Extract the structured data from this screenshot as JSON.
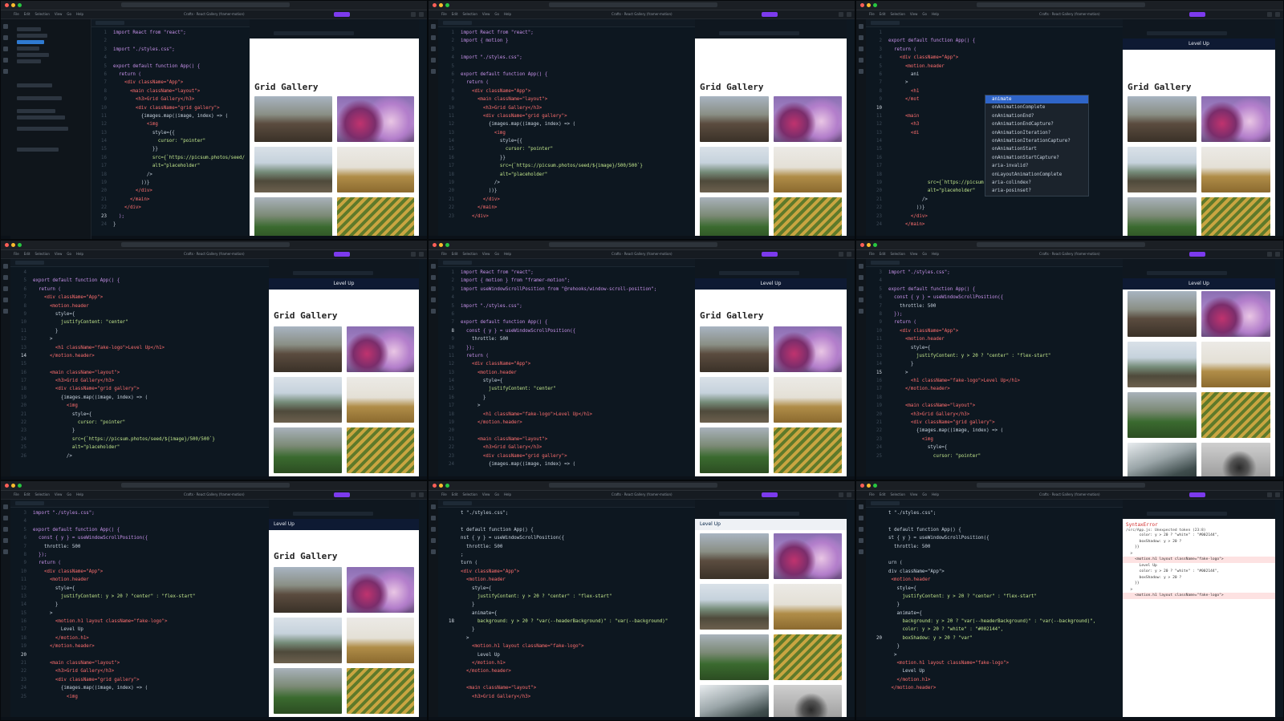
{
  "menu": [
    "File",
    "Edit",
    "Selection",
    "View",
    "Go",
    "Help"
  ],
  "project_title": "Crafts · React Gallery (framer-motion)",
  "code_tab": "App.jsx",
  "preview": {
    "gallery_title": "Grid Gallery",
    "header_logo": "Level Up"
  },
  "autocomplete": [
    "animate",
    "onAnimationComplete",
    "onAnimationEnd?",
    "onAnimationEndCapture?",
    "onAnimationIteration?",
    "onAnimationIterationCapture?",
    "onAnimationStart",
    "onAnimationStartCapture?",
    "aria-invalid?",
    "onLayoutAnimationComplete",
    "aria-colindex?",
    "aria-posinset?"
  ],
  "error": {
    "title": "SyntaxError",
    "message": "/src/App.js: Unexpected token (23:8)",
    "lines": [
      "      color: y > 20 ? \"white\" : \"#002144\",",
      "      boxShadow: y > 20 ?",
      "    }}",
      "  >",
      "    <motion.h1 layout className=\"fake-logo\">",
      "      Level Up",
      "      color: y > 20 ? \"white\" : \"#002144\",",
      "      boxShadow: y > 20 ?",
      "    }}",
      "  >",
      "    <motion.h1 layout className=\"fake-logo\">"
    ]
  },
  "panels": [
    {
      "id": "p1",
      "lines": [
        {
          "n": "1",
          "t": "import React from \"react\";"
        },
        {
          "n": "2",
          "t": ""
        },
        {
          "n": "3",
          "t": "import \"./styles.css\";"
        },
        {
          "n": "4",
          "t": ""
        },
        {
          "n": "5",
          "t": "export default function App() {"
        },
        {
          "n": "6",
          "t": "  return ("
        },
        {
          "n": "7",
          "t": "    <div className=\"App\">"
        },
        {
          "n": "8",
          "t": "      <main className=\"layout\">"
        },
        {
          "n": "9",
          "t": "        <h3>Grid Gallery</h3>"
        },
        {
          "n": "10",
          "t": "        <div className=\"grid gallery\">"
        },
        {
          "n": "11",
          "t": "          {images.map((image, index) => ("
        },
        {
          "n": "12",
          "t": "            <img"
        },
        {
          "n": "13",
          "t": "              style={{"
        },
        {
          "n": "14",
          "t": "                cursor: \"pointer\""
        },
        {
          "n": "15",
          "t": "              }}"
        },
        {
          "n": "16",
          "t": "              src={`https://picsum.photos/seed/"
        },
        {
          "n": "17",
          "t": "              alt=\"placeholder\""
        },
        {
          "n": "18",
          "t": "            />"
        },
        {
          "n": "19",
          "t": "          ))}"
        },
        {
          "n": "20",
          "t": "        </div>"
        },
        {
          "n": "21",
          "t": "      </main>"
        },
        {
          "n": "22",
          "t": "    </div>"
        },
        {
          "n": "23",
          "t": "  );"
        },
        {
          "n": "24",
          "t": "}"
        }
      ]
    },
    {
      "id": "p2",
      "lines": [
        {
          "n": "1",
          "t": "import React from \"react\";"
        },
        {
          "n": "2",
          "t": "import { motion }"
        },
        {
          "n": "3",
          "t": ""
        },
        {
          "n": "4",
          "t": "import \"./styles.css\";"
        },
        {
          "n": "5",
          "t": ""
        },
        {
          "n": "6",
          "t": "export default function App() {"
        },
        {
          "n": "7",
          "t": "  return ("
        },
        {
          "n": "8",
          "t": "    <div className=\"App\">"
        },
        {
          "n": "9",
          "t": "      <main className=\"layout\">"
        },
        {
          "n": "10",
          "t": "        <h3>Grid Gallery</h3>"
        },
        {
          "n": "11",
          "t": "        <div className=\"grid gallery\">"
        },
        {
          "n": "12",
          "t": "          {images.map((image, index) => ("
        },
        {
          "n": "13",
          "t": "            <img"
        },
        {
          "n": "14",
          "t": "              style={{"
        },
        {
          "n": "15",
          "t": "                cursor: \"pointer\""
        },
        {
          "n": "16",
          "t": "              }}"
        },
        {
          "n": "17",
          "t": "              src={`https://picsum.photos/seed/${image}/500/500`}"
        },
        {
          "n": "18",
          "t": "              alt=\"placeholder\""
        },
        {
          "n": "19",
          "t": "            />"
        },
        {
          "n": "20",
          "t": "          ))}"
        },
        {
          "n": "21",
          "t": "        </div>"
        },
        {
          "n": "22",
          "t": "      </main>"
        },
        {
          "n": "23",
          "t": "    </div>"
        }
      ]
    },
    {
      "id": "p3",
      "lines": [
        {
          "n": "1",
          "t": ""
        },
        {
          "n": "2",
          "t": "export default function App() {"
        },
        {
          "n": "3",
          "t": "  return ("
        },
        {
          "n": "4",
          "t": "    <div className=\"App\">"
        },
        {
          "n": "5",
          "t": "      <motion.header"
        },
        {
          "n": "6",
          "t": "        ani"
        },
        {
          "n": "7",
          "t": "      >"
        },
        {
          "n": "8",
          "t": "        <h1"
        },
        {
          "n": "9",
          "t": "      </mot"
        },
        {
          "n": "10",
          "t": ""
        },
        {
          "n": "11",
          "t": "      <main"
        },
        {
          "n": "12",
          "t": "        <h3"
        },
        {
          "n": "13",
          "t": "        <di"
        },
        {
          "n": "14",
          "t": ""
        },
        {
          "n": "15",
          "t": ""
        },
        {
          "n": "16",
          "t": ""
        },
        {
          "n": "17",
          "t": ""
        },
        {
          "n": "18",
          "t": ""
        },
        {
          "n": "19",
          "t": "              src={`https://picsum.photos/seed/${image}/500/500`}"
        },
        {
          "n": "20",
          "t": "              alt=\"placeholder\""
        },
        {
          "n": "21",
          "t": "            />"
        },
        {
          "n": "22",
          "t": "          ))}"
        },
        {
          "n": "23",
          "t": "        </div>"
        },
        {
          "n": "24",
          "t": "      </main>"
        }
      ]
    },
    {
      "id": "p4",
      "lines": [
        {
          "n": "4",
          "t": ""
        },
        {
          "n": "5",
          "t": "export default function App() {"
        },
        {
          "n": "6",
          "t": "  return ("
        },
        {
          "n": "7",
          "t": "    <div className=\"App\">"
        },
        {
          "n": "8",
          "t": "      <motion.header"
        },
        {
          "n": "9",
          "t": "        style={"
        },
        {
          "n": "10",
          "t": "          justifyContent: \"center\""
        },
        {
          "n": "11",
          "t": "        }"
        },
        {
          "n": "12",
          "t": "      >"
        },
        {
          "n": "13",
          "t": "        <h1 className=\"fake-logo\">Level Up</h1>"
        },
        {
          "n": "14",
          "t": "      </motion.header>"
        },
        {
          "n": "15",
          "t": ""
        },
        {
          "n": "16",
          "t": "      <main className=\"layout\">"
        },
        {
          "n": "17",
          "t": "        <h3>Grid Gallery</h3>"
        },
        {
          "n": "18",
          "t": "        <div className=\"grid gallery\">"
        },
        {
          "n": "19",
          "t": "          {images.map((image, index) => ("
        },
        {
          "n": "20",
          "t": "            <img"
        },
        {
          "n": "21",
          "t": "              style={"
        },
        {
          "n": "22",
          "t": "                cursor: \"pointer\""
        },
        {
          "n": "23",
          "t": "              }"
        },
        {
          "n": "24",
          "t": "              src={`https://picsum.photos/seed/${image}/500/500`}"
        },
        {
          "n": "25",
          "t": "              alt=\"placeholder\""
        },
        {
          "n": "26",
          "t": "            />"
        }
      ]
    },
    {
      "id": "p5",
      "lines": [
        {
          "n": "1",
          "t": "import React from \"react\";"
        },
        {
          "n": "2",
          "t": "import { motion } from \"framer-motion\";"
        },
        {
          "n": "3",
          "t": "import useWindowScrollPosition from \"@rehooks/window-scroll-position\";"
        },
        {
          "n": "4",
          "t": ""
        },
        {
          "n": "5",
          "t": "import \"./styles.css\";"
        },
        {
          "n": "6",
          "t": ""
        },
        {
          "n": "7",
          "t": "export default function App() {"
        },
        {
          "n": "8",
          "t": "  const { y } = useWindowScrollPosition({"
        },
        {
          "n": "9",
          "t": "    throttle: 500"
        },
        {
          "n": "10",
          "t": "  });"
        },
        {
          "n": "11",
          "t": "  return ("
        },
        {
          "n": "12",
          "t": "    <div className=\"App\">"
        },
        {
          "n": "13",
          "t": "      <motion.header"
        },
        {
          "n": "14",
          "t": "        style={"
        },
        {
          "n": "15",
          "t": "          justifyContent: \"center\""
        },
        {
          "n": "16",
          "t": "        }"
        },
        {
          "n": "17",
          "t": "      >"
        },
        {
          "n": "18",
          "t": "        <h1 className=\"fake-logo\">Level Up</h1>"
        },
        {
          "n": "19",
          "t": "      </motion.header>"
        },
        {
          "n": "20",
          "t": ""
        },
        {
          "n": "21",
          "t": "      <main className=\"layout\">"
        },
        {
          "n": "22",
          "t": "        <h3>Grid Gallery</h3>"
        },
        {
          "n": "23",
          "t": "        <div className=\"grid gallery\">"
        },
        {
          "n": "24",
          "t": "          {images.map((image, index) => ("
        }
      ]
    },
    {
      "id": "p6",
      "lines": [
        {
          "n": "3",
          "t": "import \"./styles.css\";"
        },
        {
          "n": "4",
          "t": ""
        },
        {
          "n": "5",
          "t": "export default function App() {"
        },
        {
          "n": "6",
          "t": "  const { y } = useWindowScrollPosition({"
        },
        {
          "n": "7",
          "t": "    throttle: 500"
        },
        {
          "n": "8",
          "t": "  });"
        },
        {
          "n": "9",
          "t": "  return ("
        },
        {
          "n": "10",
          "t": "    <div className=\"App\">"
        },
        {
          "n": "11",
          "t": "      <motion.header"
        },
        {
          "n": "12",
          "t": "        style={"
        },
        {
          "n": "13",
          "t": "          justifyContent: y > 20 ? \"center\" : \"flex-start\""
        },
        {
          "n": "14",
          "t": "        }"
        },
        {
          "n": "15",
          "t": "      >"
        },
        {
          "n": "16",
          "t": "        <h1 className=\"fake-logo\">Level Up</h1>"
        },
        {
          "n": "17",
          "t": "      </motion.header>"
        },
        {
          "n": "18",
          "t": ""
        },
        {
          "n": "19",
          "t": "      <main className=\"layout\">"
        },
        {
          "n": "20",
          "t": "        <h3>Grid Gallery</h3>"
        },
        {
          "n": "21",
          "t": "        <div className=\"grid gallery\">"
        },
        {
          "n": "22",
          "t": "          {images.map((image, index) => ("
        },
        {
          "n": "23",
          "t": "            <img"
        },
        {
          "n": "24",
          "t": "              style={"
        },
        {
          "n": "25",
          "t": "                cursor: \"pointer\""
        }
      ]
    },
    {
      "id": "p7",
      "lines": [
        {
          "n": "3",
          "t": "import \"./styles.css\";"
        },
        {
          "n": "4",
          "t": ""
        },
        {
          "n": "5",
          "t": "export default function App() {"
        },
        {
          "n": "6",
          "t": "  const { y } = useWindowScrollPosition({"
        },
        {
          "n": "7",
          "t": "    throttle: 500"
        },
        {
          "n": "8",
          "t": "  });"
        },
        {
          "n": "9",
          "t": "  return ("
        },
        {
          "n": "10",
          "t": "    <div className=\"App\">"
        },
        {
          "n": "11",
          "t": "      <motion.header"
        },
        {
          "n": "12",
          "t": "        style={"
        },
        {
          "n": "13",
          "t": "          justifyContent: y > 20 ? \"center\" : \"flex-start\""
        },
        {
          "n": "14",
          "t": "        }"
        },
        {
          "n": "15",
          "t": "      >"
        },
        {
          "n": "16",
          "t": "        <motion.h1 layout className=\"fake-logo\">"
        },
        {
          "n": "17",
          "t": "          Level Up"
        },
        {
          "n": "18",
          "t": "        </motion.h1>"
        },
        {
          "n": "19",
          "t": "      </motion.header>"
        },
        {
          "n": "20",
          "t": ""
        },
        {
          "n": "21",
          "t": "      <main className=\"layout\">"
        },
        {
          "n": "22",
          "t": "        <h3>Grid Gallery</h3>"
        },
        {
          "n": "23",
          "t": "        <div className=\"grid gallery\">"
        },
        {
          "n": "24",
          "t": "          {images.map((image, index) => ("
        },
        {
          "n": "25",
          "t": "            <img"
        }
      ]
    },
    {
      "id": "p8",
      "lines": [
        {
          "n": "",
          "t": "t \"./styles.css\";"
        },
        {
          "n": "",
          "t": ""
        },
        {
          "n": "",
          "t": "t default function App() {"
        },
        {
          "n": "",
          "t": "nst { y } = useWindowScrollPosition({"
        },
        {
          "n": "",
          "t": "  throttle: 500"
        },
        {
          "n": "",
          "t": ";"
        },
        {
          "n": "",
          "t": "turn ("
        },
        {
          "n": "",
          "t": "<div className=\"App\">"
        },
        {
          "n": "",
          "t": "  <motion.header"
        },
        {
          "n": "",
          "t": "    style={"
        },
        {
          "n": "",
          "t": "      justifyContent: y > 20 ? \"center\" : \"flex-start\""
        },
        {
          "n": "",
          "t": "    }"
        },
        {
          "n": "",
          "t": "    animate={"
        },
        {
          "n": "18",
          "t": "      background: y > 20 ? \"var(--headerBackground)\" : \"var(--background)\""
        },
        {
          "n": "",
          "t": "    }"
        },
        {
          "n": "",
          "t": "  >"
        },
        {
          "n": "",
          "t": "    <motion.h1 layout className=\"fake-logo\">"
        },
        {
          "n": "",
          "t": "      Level Up"
        },
        {
          "n": "",
          "t": "    </motion.h1>"
        },
        {
          "n": "",
          "t": "  </motion.header>"
        },
        {
          "n": "",
          "t": ""
        },
        {
          "n": "",
          "t": "  <main className=\"layout\">"
        },
        {
          "n": "",
          "t": "    <h3>Grid Gallery</h3>"
        }
      ]
    },
    {
      "id": "p9",
      "lines": [
        {
          "n": "",
          "t": "t \"./styles.css\";"
        },
        {
          "n": "",
          "t": ""
        },
        {
          "n": "",
          "t": "t default function App() {"
        },
        {
          "n": "",
          "t": "st { y } = useWindowScrollPosition({"
        },
        {
          "n": "",
          "t": "  throttle: 500"
        },
        {
          "n": "",
          "t": ""
        },
        {
          "n": "",
          "t": "urn ("
        },
        {
          "n": "",
          "t": "div className=\"App\">"
        },
        {
          "n": "",
          "t": " <motion.header"
        },
        {
          "n": "",
          "t": "   style={"
        },
        {
          "n": "",
          "t": "     justifyContent: y > 20 ? \"center\" : \"flex-start\""
        },
        {
          "n": "",
          "t": "   }"
        },
        {
          "n": "",
          "t": "   animate={"
        },
        {
          "n": "",
          "t": "     background: y > 20 ? \"var(--headerBackground)\" : \"var(--background)\","
        },
        {
          "n": "",
          "t": "     color: y > 20 ? \"white\" : \"#002144\","
        },
        {
          "n": "20",
          "t": "     boxShadow: y > 20 ? \"var\""
        },
        {
          "n": "",
          "t": "   }"
        },
        {
          "n": "",
          "t": "  >"
        },
        {
          "n": "",
          "t": "   <motion.h1 layout className=\"fake-logo\">"
        },
        {
          "n": "",
          "t": "     Level Up"
        },
        {
          "n": "",
          "t": "   </motion.h1>"
        },
        {
          "n": "",
          "t": " </motion.header>"
        }
      ]
    }
  ]
}
